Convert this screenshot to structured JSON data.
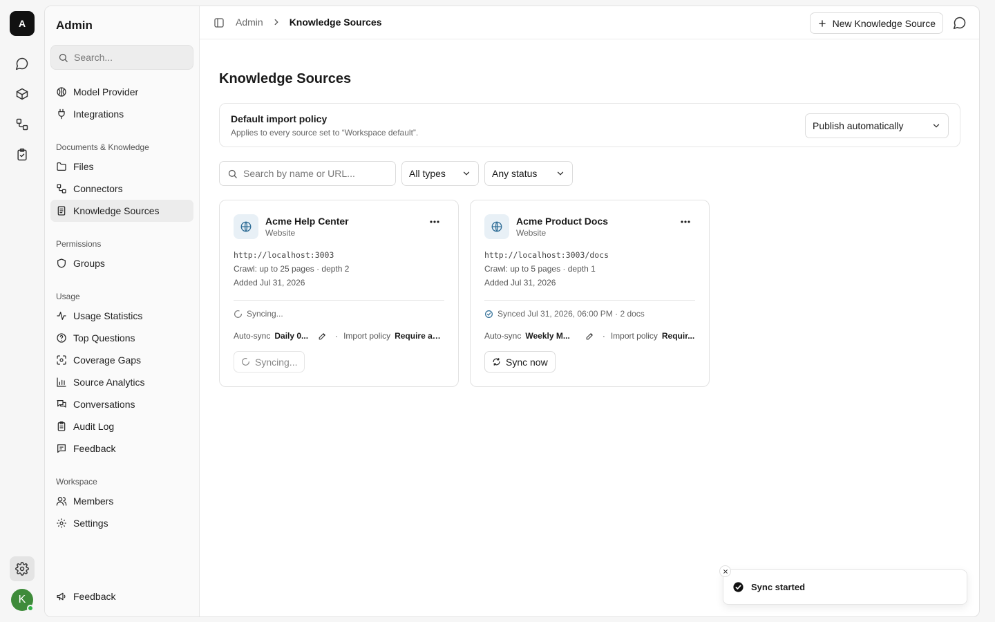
{
  "rail": {
    "logo_letter": "A",
    "avatar_letter": "K"
  },
  "sidebar": {
    "title": "Admin",
    "search_placeholder": "Search...",
    "top_items": [
      {
        "label": "Model Provider",
        "icon": "brain-icon"
      },
      {
        "label": "Integrations",
        "icon": "plug-icon"
      }
    ],
    "sections": [
      {
        "title": "Documents & Knowledge",
        "items": [
          {
            "label": "Files",
            "icon": "folder-icon"
          },
          {
            "label": "Connectors",
            "icon": "connector-icon"
          },
          {
            "label": "Knowledge Sources",
            "icon": "document-icon",
            "active": true
          }
        ]
      },
      {
        "title": "Permissions",
        "items": [
          {
            "label": "Groups",
            "icon": "shield-icon"
          }
        ]
      },
      {
        "title": "Usage",
        "items": [
          {
            "label": "Usage Statistics",
            "icon": "activity-icon"
          },
          {
            "label": "Top Questions",
            "icon": "help-circle-icon"
          },
          {
            "label": "Coverage Gaps",
            "icon": "scan-icon"
          },
          {
            "label": "Source Analytics",
            "icon": "bar-chart-icon"
          },
          {
            "label": "Conversations",
            "icon": "chat-bubbles-icon"
          },
          {
            "label": "Audit Log",
            "icon": "clipboard-icon"
          },
          {
            "label": "Feedback",
            "icon": "message-square-icon"
          }
        ]
      },
      {
        "title": "Workspace",
        "items": [
          {
            "label": "Members",
            "icon": "users-icon"
          },
          {
            "label": "Settings",
            "icon": "gear-icon"
          }
        ]
      }
    ],
    "footer_feedback": "Feedback"
  },
  "topbar": {
    "breadcrumb_root": "Admin",
    "breadcrumb_current": "Knowledge Sources",
    "new_button": "New Knowledge Source"
  },
  "main": {
    "title": "Knowledge Sources",
    "policy": {
      "title": "Default import policy",
      "subtitle": "Applies to every source set to “Workspace default”.",
      "selected": "Publish automatically"
    },
    "filters": {
      "search_placeholder": "Search by name or URL...",
      "type": "All types",
      "status": "Any status"
    },
    "cards": [
      {
        "name": "Acme Help Center",
        "type": "Website",
        "url": "http://localhost:3003",
        "crawl": "Crawl: up to 25 pages · depth 2",
        "added": "Added Jul 31, 2026",
        "status": "Syncing...",
        "autosync_label": "Auto-sync",
        "autosync_value": "Daily 0...",
        "import_label": "Import policy",
        "import_value": "Require ap...",
        "button": "Syncing..."
      },
      {
        "name": "Acme Product Docs",
        "type": "Website",
        "url": "http://localhost:3003/docs",
        "crawl": "Crawl: up to 5 pages · depth 1",
        "added": "Added Jul 31, 2026",
        "status": "Synced Jul 31, 2026, 06:00 PM · 2 docs",
        "autosync_label": "Auto-sync",
        "autosync_value": "Weekly M...",
        "import_label": "Import policy",
        "import_value": "Requir...",
        "button": "Sync now"
      }
    ]
  },
  "toast": {
    "message": "Sync started"
  }
}
